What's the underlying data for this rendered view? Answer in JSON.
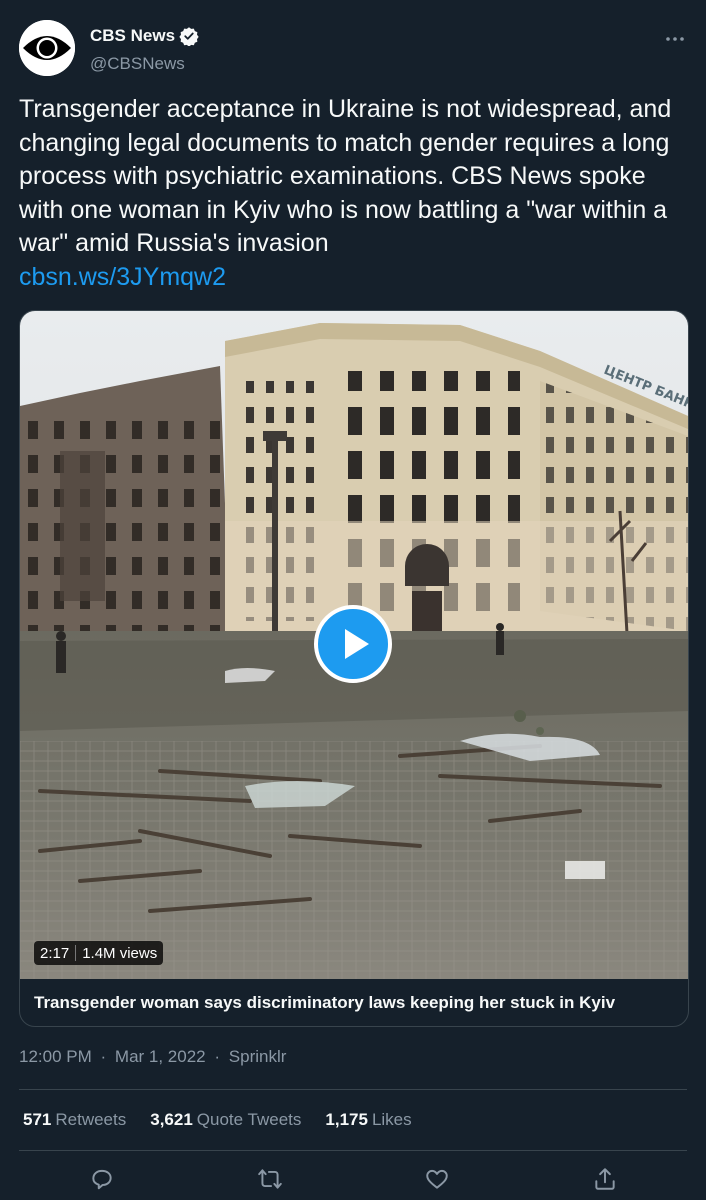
{
  "author": {
    "display_name": "CBS News",
    "handle": "@CBSNews",
    "verified": true,
    "avatar_icon": "cbs-eye-logo"
  },
  "tweet": {
    "text": "Transgender acceptance in Ukraine is not widespread, and changing legal documents to match gender requires a long process with psychiatric examinations. CBS News spoke with one woman in Kyiv who is now battling a \"war within a war\" amid Russia's invasion",
    "link": "cbsn.ws/3JYmqw2"
  },
  "media": {
    "duration": "2:17",
    "views": "1.4M views",
    "title": "Transgender woman says discriminatory laws keeping her stuck in Kyiv",
    "building_sign": "ЦЕНТР БАНК"
  },
  "meta": {
    "time": "12:00 PM",
    "date": "Mar 1, 2022",
    "source": "Sprinklr",
    "dot": "·"
  },
  "stats": {
    "retweets_count": "571",
    "retweets_label": "Retweets",
    "quotes_count": "3,621",
    "quotes_label": "Quote Tweets",
    "likes_count": "1,175",
    "likes_label": "Likes"
  },
  "colors": {
    "background": "#15202b",
    "text": "#f7f9f9",
    "secondary": "#8b98a5",
    "accent": "#1d9bf0",
    "border": "#38444d"
  },
  "icons": [
    "verified-badge-icon",
    "more-icon",
    "play-icon",
    "reply-icon",
    "retweet-icon",
    "like-icon",
    "share-icon"
  ]
}
